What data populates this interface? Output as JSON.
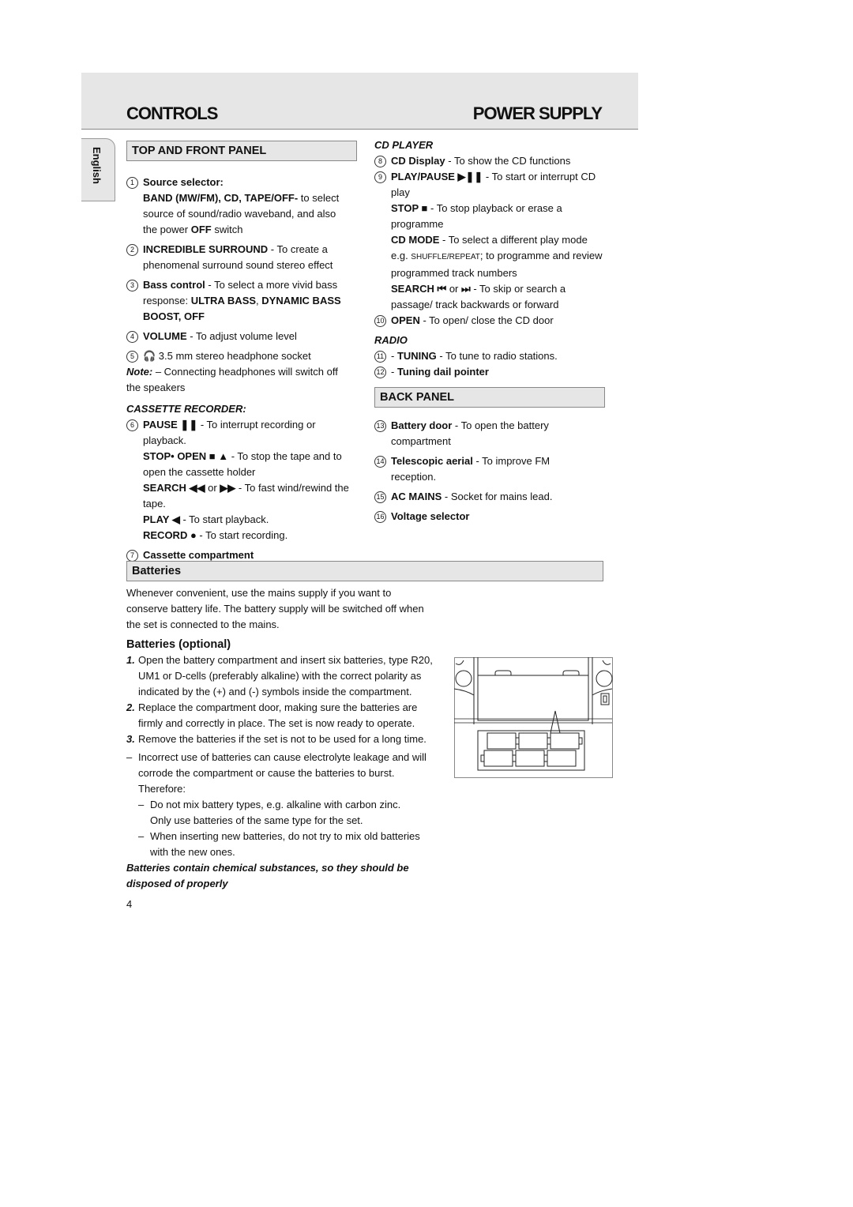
{
  "header": {
    "left_title": "CONTROLS",
    "right_title": "POWER SUPPLY"
  },
  "language_tab": "English",
  "left": [
    {
      "type": "box",
      "title": "TOP AND FRONT PANEL"
    },
    {
      "type": "item",
      "num": "1",
      "segs": [
        [
          "b",
          "Source selector:\n"
        ],
        [
          "b",
          "BAND (MW/FM), CD, TAPE/OFF-"
        ],
        [
          "n",
          " to select\nsource of sound/radio waveband, and also\nthe power "
        ],
        [
          "b",
          "OFF"
        ],
        [
          "n",
          " switch"
        ]
      ]
    },
    {
      "type": "item",
      "num": "2",
      "segs": [
        [
          "b",
          "INCREDIBLE SURROUND"
        ],
        [
          "n",
          " - To create a\nphenomenal surround sound stereo effect"
        ]
      ]
    },
    {
      "type": "item",
      "num": "3",
      "segs": [
        [
          "b",
          "Bass control"
        ],
        [
          "n",
          " - To select a more vivid bass\nresponse:  "
        ],
        [
          "b",
          "ULTRA BASS"
        ],
        [
          "n",
          ", "
        ],
        [
          "b",
          "DYNAMIC BASS\nBOOST, OFF"
        ]
      ]
    },
    {
      "type": "item",
      "num": "4",
      "segs": [
        [
          "b",
          "VOLUME"
        ],
        [
          "n",
          " - To adjust volume level"
        ]
      ]
    },
    {
      "type": "item",
      "num": "5",
      "segs": [
        [
          "n",
          "🎧 3.5 mm stereo headphone socket"
        ]
      ]
    },
    {
      "type": "note",
      "segs": [
        [
          "bi",
          "Note:"
        ],
        [
          "n",
          " – Connecting headphones will switch off\n               the speakers"
        ]
      ]
    },
    {
      "type": "sub",
      "title": "CASSETTE RECORDER:"
    },
    {
      "type": "item",
      "num": "6",
      "segs": [
        [
          "b",
          "PAUSE ❚❚"
        ],
        [
          "n",
          " - To interrupt recording or playback.\n"
        ],
        [
          "b",
          "STOP• OPEN ■ ▲"
        ],
        [
          "n",
          " - To stop the tape and to\nopen the cassette holder\n"
        ],
        [
          "b",
          "SEARCH ◀◀"
        ],
        [
          "n",
          " or "
        ],
        [
          "b",
          "▶▶"
        ],
        [
          "n",
          " - To fast wind/rewind the\ntape.\n"
        ],
        [
          "b",
          "PLAY ◀"
        ],
        [
          "n",
          " - To start playback.\n"
        ],
        [
          "b",
          "RECORD ●"
        ],
        [
          "n",
          " - To start recording."
        ]
      ]
    },
    {
      "type": "item",
      "num": "7",
      "segs": [
        [
          "b",
          "Cassette compartment"
        ]
      ]
    }
  ],
  "right": [
    {
      "type": "sub",
      "title": "CD PLAYER"
    },
    {
      "type": "item",
      "num": "8",
      "segs": [
        [
          "b",
          "CD Display"
        ],
        [
          "n",
          " - To show the CD functions"
        ]
      ]
    },
    {
      "type": "item",
      "num": "9",
      "segs": [
        [
          "b",
          "PLAY/PAUSE ▶❚❚"
        ],
        [
          "n",
          " - To start or interrupt CD\nplay\n"
        ],
        [
          "b",
          "STOP ■"
        ],
        [
          "n",
          " - To stop playback or erase a\nprogramme\n"
        ],
        [
          "b",
          "CD MODE"
        ],
        [
          "n",
          " - To select a different play mode\ne.g. "
        ],
        [
          "sc",
          "SHUFFLE/REPEAT"
        ],
        [
          "n",
          "; to programme and review\nprogrammed track numbers\n"
        ],
        [
          "b",
          "SEARCH ⏮"
        ],
        [
          "n",
          " or "
        ],
        [
          "b",
          "⏭"
        ],
        [
          "n",
          " - To skip or search a\npassage/ track backwards or forward"
        ]
      ]
    },
    {
      "type": "item",
      "num": "10",
      "segs": [
        [
          "b",
          "OPEN"
        ],
        [
          "n",
          "  - To open/ close the CD door"
        ]
      ]
    },
    {
      "type": "sub",
      "title": "RADIO"
    },
    {
      "type": "item",
      "num": "11",
      "segs": [
        [
          "n",
          "- "
        ],
        [
          "b",
          "TUNING"
        ],
        [
          "n",
          " - To tune to radio stations."
        ]
      ]
    },
    {
      "type": "item",
      "num": "12",
      "segs": [
        [
          "n",
          "- "
        ],
        [
          "b",
          "Tuning dail pointer"
        ]
      ]
    },
    {
      "type": "box",
      "title": "BACK PANEL"
    },
    {
      "type": "item",
      "num": "13",
      "segs": [
        [
          "b",
          "Battery door"
        ],
        [
          "n",
          " - To open the battery\ncompartment"
        ]
      ]
    },
    {
      "type": "item",
      "num": "14",
      "segs": [
        [
          "b",
          "Telescopic aerial"
        ],
        [
          "n",
          " - To improve FM\nreception."
        ]
      ]
    },
    {
      "type": "item",
      "num": "15",
      "segs": [
        [
          "b",
          "AC MAINS"
        ],
        [
          "n",
          " - Socket for mains lead."
        ]
      ]
    },
    {
      "type": "item",
      "num": "16",
      "segs": [
        [
          "b",
          "Voltage selector"
        ]
      ]
    }
  ],
  "batteries": {
    "title": "Batteries",
    "intro": "Whenever convenient, use the mains supply if you want to\nconserve battery life. The battery supply will be switched off when\nthe set is connected to the mains.",
    "subtitle": "Batteries (optional)",
    "steps": [
      {
        "marker": "1.",
        "text": "Open the battery compartment and insert six batteries, type R20,\nUM1 or D-cells (preferably alkaline) with the correct polarity as\nindicated by the (+) and (-) symbols inside the compartment."
      },
      {
        "marker": "2.",
        "text": "Replace the compartment door, making sure the batteries are\nfirmly and correctly in place. The set is now ready to operate."
      },
      {
        "marker": "3.",
        "text": "Remove the batteries if the set is not to be used for a long time."
      }
    ],
    "warning": {
      "marker": "–",
      "text": "Incorrect use of batteries can cause electrolyte leakage and will\ncorrode the compartment or cause the batteries to burst.\nTherefore:"
    },
    "sub_warnings": [
      {
        "marker": "–",
        "text": "Do not mix battery types, e.g. alkaline with carbon zinc.\nOnly use batteries of the same type for the set."
      },
      {
        "marker": "–",
        "text": "When inserting new batteries, do not try to mix old batteries\nwith the new ones."
      }
    ],
    "final_note": "Batteries contain chemical substances, so they should be\ndisposed of properly"
  },
  "page_number": "4"
}
